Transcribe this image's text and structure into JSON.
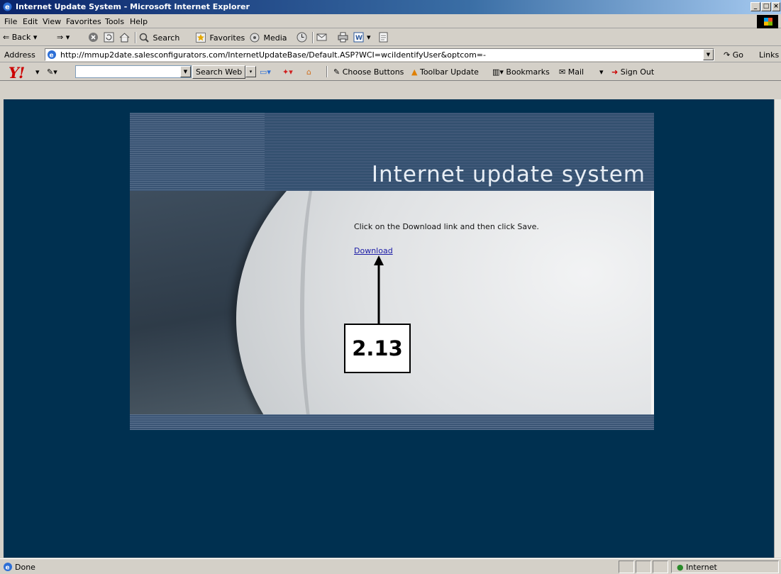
{
  "window": {
    "title": "Internet Update System - Microsoft Internet Explorer",
    "controls": {
      "minimize": "_",
      "maximize": "□",
      "close": "×"
    }
  },
  "menu": {
    "items": [
      {
        "label": "File"
      },
      {
        "label": "Edit"
      },
      {
        "label": "View"
      },
      {
        "label": "Favorites"
      },
      {
        "label": "Tools"
      },
      {
        "label": "Help"
      }
    ]
  },
  "toolbar": {
    "back": "Back",
    "search": "Search",
    "favorites": "Favorites",
    "media": "Media"
  },
  "address": {
    "label": "Address",
    "url": "http://mmup2date.salesconfigurators.com/InternetUpdateBase/Default.ASP?WCI=wciIdentifyUser&optcom=-",
    "go": "Go",
    "links": "Links"
  },
  "yahoo_toolbar": {
    "logo": "Y!",
    "search_value": "",
    "search_button": "Search Web",
    "choose_buttons": "Choose Buttons",
    "toolbar_update": "Toolbar Update",
    "bookmarks": "Bookmarks",
    "mail": "Mail",
    "sign_out": "Sign Out"
  },
  "page": {
    "banner_title": "Internet update system",
    "instruction": "Click on the Download link and then click Save.",
    "download_link": "Download",
    "callout_label": "2.13"
  },
  "status": {
    "text": "Done",
    "zone": "Internet"
  },
  "colors": {
    "page_background": "#003050",
    "link": "#1a1aa6",
    "titlebar": "#0a246a"
  }
}
